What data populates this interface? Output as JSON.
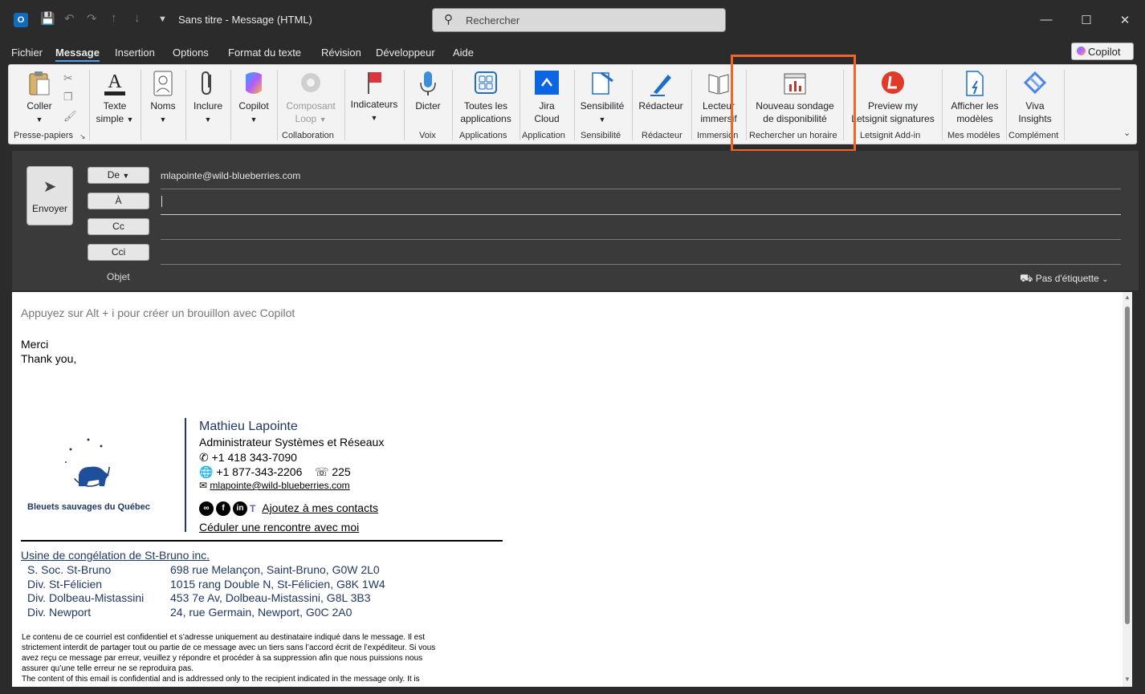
{
  "window": {
    "title": "Sans titre  -  Message (HTML)",
    "search_placeholder": "Rechercher"
  },
  "menu": [
    "Fichier",
    "Message",
    "Insertion",
    "Options",
    "Format du texte",
    "Révision",
    "Développeur",
    "Aide"
  ],
  "copilot_label": "Copilot",
  "ribbon": {
    "paste": "Coller",
    "clipboard_group": "Presse-papiers",
    "basic_text": "Texte",
    "basic_text2": "simple",
    "names": "Noms",
    "include": "Inclure",
    "copilot": "Copilot",
    "loop1": "Composant",
    "loop2": "Loop",
    "collab_group": "Collaboration",
    "tags": "Indicateurs",
    "dictate": "Dicter",
    "voice_group": "Voix",
    "allapps1": "Toutes les",
    "allapps2": "applications",
    "apps_group": "Applications",
    "jira1": "Jira",
    "jira2": "Cloud",
    "app_group": "Application",
    "sens": "Sensibilité",
    "sens_group": "Sensibilité",
    "editor": "Rédacteur",
    "editor_group": "Rédacteur",
    "reader1": "Lecteur",
    "reader2": "immersif",
    "immersion_group": "Immersion",
    "poll1": "Nouveau sondage",
    "poll2": "de disponibilité",
    "poll_group": "Rechercher un horaire",
    "preview1": "Preview my",
    "preview2": "Letsignit signatures",
    "letsignit_group": "Letsignit Add-in",
    "templates1": "Afficher les",
    "templates2": "modèles",
    "templates_group": "Mes modèles",
    "viva1": "Viva",
    "viva2": "Insights",
    "addin_group": "Complément"
  },
  "compose": {
    "send": "Envoyer",
    "from_btn": "De",
    "from_value": "mlapointe@wild-blueberries.com",
    "to_btn": "À",
    "cc_btn": "Cc",
    "bcc_btn": "Cci",
    "subject_label": "Objet",
    "sensitivity": "Pas d'étiquette"
  },
  "body": {
    "copilot_hint": "Appuyez sur Alt + i pour créer un brouillon avec Copilot",
    "line1": "Merci",
    "line2": "Thank you,"
  },
  "signature": {
    "logo_text": "Bleuets sauvages du Québec",
    "name": "Mathieu Lapointe",
    "title": "Administrateur Systèmes et Réseaux",
    "phone": "+1 418 343-7090",
    "tollfree": "+1 877-343-2206",
    "ext": "225",
    "email": "mlapointe@wild-blueberries.com",
    "add_contacts": "Ajoutez à mes contacts",
    "schedule": "Céduler une rencontre avec moi",
    "company": "Usine de congélation de St-Bruno inc.",
    "sites": [
      {
        "name": "S. Soc. St-Bruno",
        "addr": "698 rue Melançon, Saint-Bruno, G0W 2L0"
      },
      {
        "name": "Div. St-Félicien",
        "addr": "1015 rang Double N, St-Félicien, G8K 1W4"
      },
      {
        "name": "Div. Dolbeau-Mistassini",
        "addr": "453 7e Av, Dolbeau-Mistassini, G8L 3B3"
      },
      {
        "name": "Div. Newport",
        "addr": "24, rue Germain, Newport, G0C 2A0"
      }
    ],
    "disclaimer_fr": [
      "Le contenu de ce courriel est confidentiel et s’adresse uniquement au destinataire indiqué dans le message. Il est",
      "strictement interdit de partager tout ou partie de ce message avec un tiers sans l’accord écrit de l’expéditeur. Si vous",
      "avez reçu ce message par erreur, veuillez y répondre et procéder à sa suppression afin que nous puissions nous",
      "assurer qu’une telle erreur ne se reproduira pas."
    ],
    "disclaimer_en": [
      "The content of this email is confidential and is addressed only to the recipient indicated in the message only. It is"
    ]
  },
  "accent_colors": {
    "highlight": "#f26522",
    "signature_blue": "#1f3864",
    "active_tab": "#4a9ef5"
  }
}
